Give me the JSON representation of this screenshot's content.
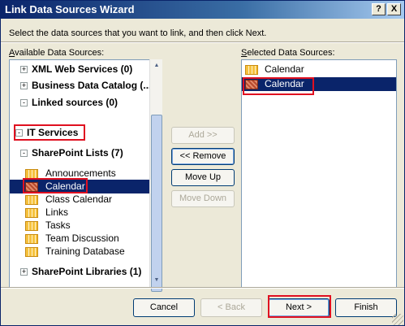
{
  "window": {
    "title": "Link Data Sources Wizard",
    "help_label": "?",
    "close_label": "X"
  },
  "instruction": "Select the data sources that you want to link, and then click Next.",
  "available": {
    "label_underline": "A",
    "label_rest": "vailable Data Sources:",
    "tree": [
      {
        "text": "XML Web Services (0)",
        "bold": true,
        "expander": "+"
      },
      {
        "text": "Business Data Catalog (...",
        "bold": true,
        "expander": "+"
      },
      {
        "text": "Linked sources (0)",
        "bold": true,
        "expander": "-"
      },
      {
        "text": "IT Services",
        "bold": true,
        "expander": "-"
      },
      {
        "text": "SharePoint Lists (7)",
        "bold": true,
        "expander": "-"
      },
      {
        "text": "Announcements",
        "bold": false,
        "icon": "list-icon"
      },
      {
        "text": "Calendar",
        "bold": false,
        "icon": "list-icon",
        "selected": true
      },
      {
        "text": "Class Calendar",
        "bold": false,
        "icon": "list-icon"
      },
      {
        "text": "Links",
        "bold": false,
        "icon": "list-icon"
      },
      {
        "text": "Tasks",
        "bold": false,
        "icon": "list-icon"
      },
      {
        "text": "Team Discussion",
        "bold": false,
        "icon": "list-icon"
      },
      {
        "text": "Training Database",
        "bold": false,
        "icon": "list-icon"
      },
      {
        "text": "SharePoint Libraries (1)",
        "bold": true,
        "expander": "+"
      }
    ]
  },
  "selected": {
    "label_underline": "S",
    "label_rest": "elected Data Sources:",
    "items": [
      {
        "text": "Calendar",
        "selected": false
      },
      {
        "text": "Calendar",
        "selected": true
      }
    ]
  },
  "buttons": {
    "add": "Add >>",
    "remove": "<< Remove",
    "move_up": "Move Up",
    "move_down": "Move Down",
    "cancel": "Cancel",
    "back": "< Back",
    "next": "Next >",
    "finish": "Finish"
  },
  "colors": {
    "highlight_accent": "#e01020",
    "selection_bg": "#0a246a"
  }
}
